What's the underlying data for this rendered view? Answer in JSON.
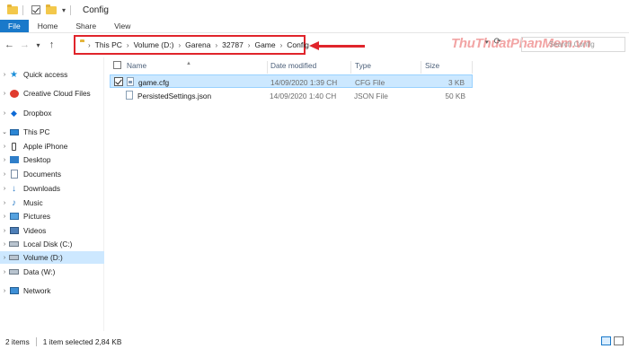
{
  "window": {
    "title": "Config"
  },
  "ribbon": {
    "tabs": [
      "File",
      "Home",
      "Share",
      "View"
    ]
  },
  "address": {
    "crumbs": [
      "This PC",
      "Volume (D:)",
      "Garena",
      "32787",
      "Game",
      "Config"
    ],
    "annotation_color": "#e0242b",
    "search_placeholder": "Search Config"
  },
  "watermark": "ThuThuatPhanMem.vn",
  "sidebar": {
    "items": [
      {
        "label": "Quick access",
        "icon": "star-icon"
      },
      {
        "label": "Creative Cloud Files",
        "icon": "creative-cloud-icon"
      },
      {
        "label": "Dropbox",
        "icon": "dropbox-icon"
      },
      {
        "label": "This PC",
        "icon": "computer-icon"
      },
      {
        "label": "Apple iPhone",
        "icon": "phone-icon"
      },
      {
        "label": "Desktop",
        "icon": "desktop-icon"
      },
      {
        "label": "Documents",
        "icon": "document-icon"
      },
      {
        "label": "Downloads",
        "icon": "download-icon"
      },
      {
        "label": "Music",
        "icon": "music-icon"
      },
      {
        "label": "Pictures",
        "icon": "picture-icon"
      },
      {
        "label": "Videos",
        "icon": "video-icon"
      },
      {
        "label": "Local Disk (C:)",
        "icon": "disk-icon"
      },
      {
        "label": "Volume (D:)",
        "icon": "disk-icon"
      },
      {
        "label": "Data (W:)",
        "icon": "disk-icon"
      },
      {
        "label": "Network",
        "icon": "network-icon"
      }
    ]
  },
  "filelist": {
    "columns": [
      "Name",
      "Date modified",
      "Type",
      "Size"
    ],
    "rows": [
      {
        "name": "game.cfg",
        "date": "14/09/2020 1:39 CH",
        "type": "CFG File",
        "size": "3 KB"
      },
      {
        "name": "PersistedSettings.json",
        "date": "14/09/2020 1:40 CH",
        "type": "JSON File",
        "size": "50 KB"
      }
    ]
  },
  "status": {
    "items_count": "2 items",
    "selection": "1 item selected  2,84 KB"
  }
}
